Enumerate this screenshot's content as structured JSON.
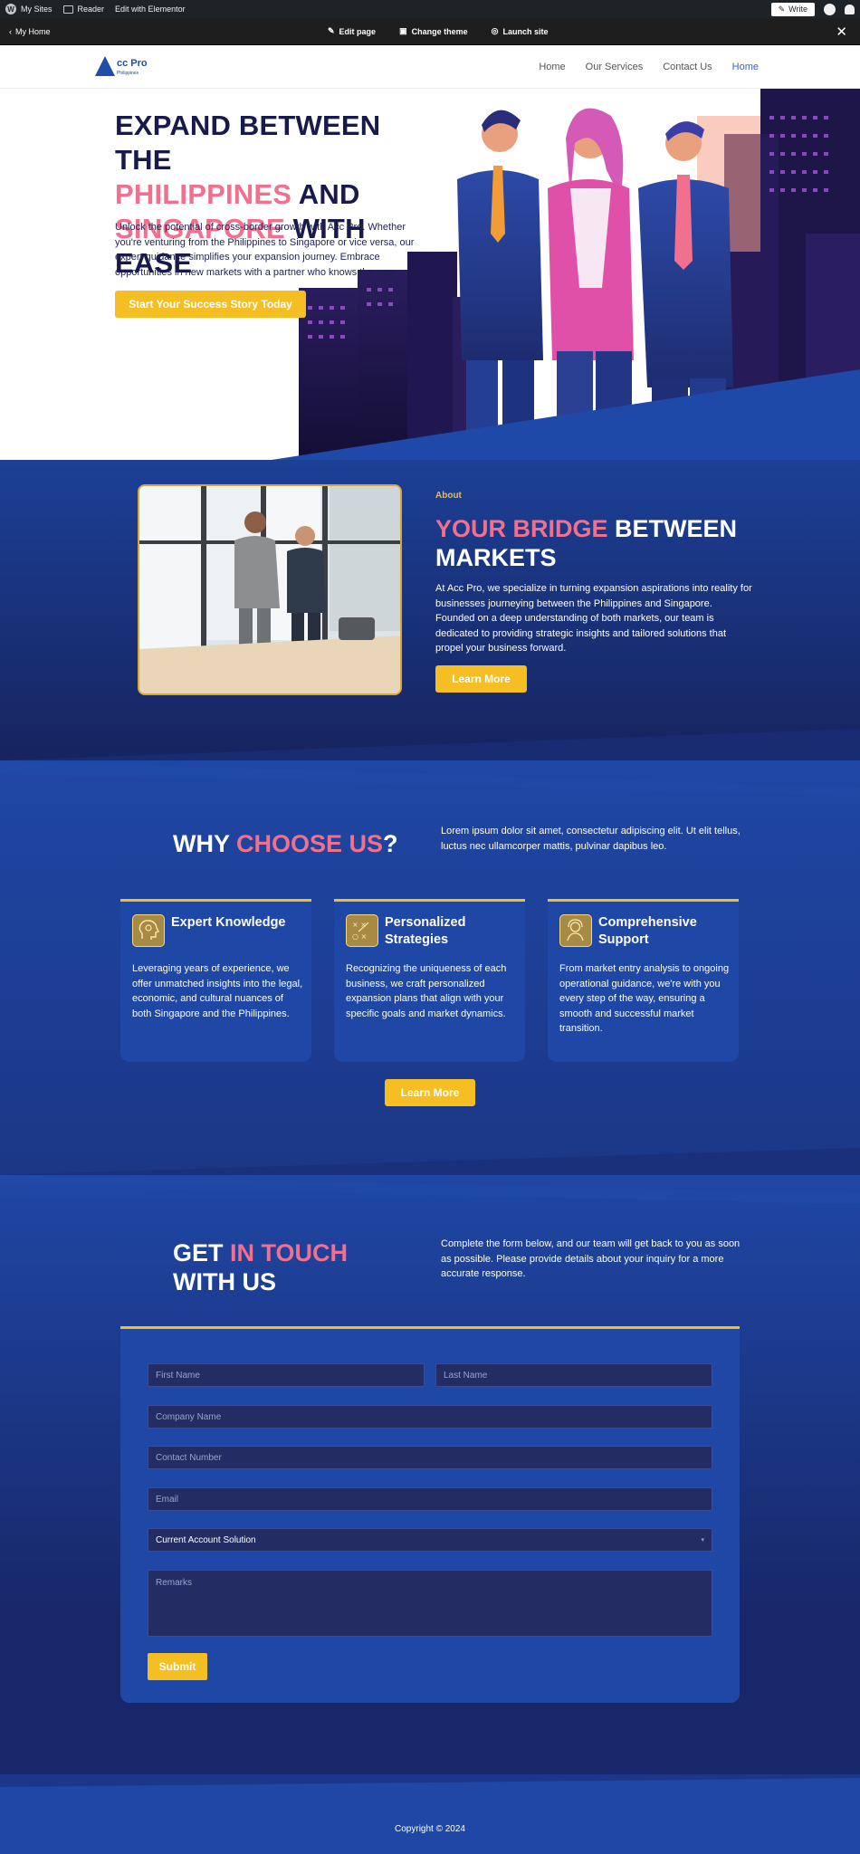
{
  "wpbar": {
    "my_sites": "My Sites",
    "reader": "Reader",
    "edit_elementor": "Edit with Elementor",
    "write": "Write"
  },
  "editor_bar": {
    "back": "My Home",
    "edit_page": "Edit page",
    "change_theme": "Change theme",
    "launch_site": "Launch site"
  },
  "header": {
    "logo_text": "cc Pro",
    "logo_sub": "Philippines",
    "nav": [
      "Home",
      "Our Services",
      "Contact Us",
      "Home"
    ]
  },
  "hero": {
    "title_line1": "EXPAND BETWEEN THE",
    "title_pink1": "PHILIPPINES",
    "title_and": " AND",
    "title_pink2": "SINGAPORE",
    "title_end": " WITH EASE",
    "description": "Unlock the potential of cross-border growth with Acc Pro. Whether you're venturing from the Philippines to Singapore or vice versa, our expert guidance simplifies your expansion journey. Embrace opportunities in new markets with a partner who knows the way.",
    "cta": "Start Your Success Story Today"
  },
  "about": {
    "label": "About",
    "title_pink": "YOUR BRIDGE",
    "title_rest": " BETWEEN MARKETS",
    "description": "At Acc Pro, we specialize in turning expansion aspirations into reality for businesses journeying between the Philippines and Singapore. Founded on a deep understanding of both markets, our team is dedicated to providing strategic insights and tailored solutions that propel your business forward.",
    "button": "Learn More"
  },
  "why": {
    "title_white": "WHY ",
    "title_pink": "CHOOSE US",
    "title_q": "?",
    "description": "Lorem ipsum dolor sit amet, consectetur adipiscing elit. Ut elit tellus, luctus nec ullamcorper mattis, pulvinar dapibus leo.",
    "cards": [
      {
        "title": "Expert Knowledge",
        "desc": "Leveraging years of experience, we offer unmatched insights into the legal, economic, and cultural nuances of both Singapore and the Philippines.",
        "icon": "head-idea-icon"
      },
      {
        "title": "Personalized Strategies",
        "desc": "Recognizing the uniqueness of each business, we craft personalized expansion plans that align with your specific goals and market dynamics.",
        "icon": "strategy-board-icon"
      },
      {
        "title": "Comprehensive Support",
        "desc": "From market entry analysis to ongoing operational guidance, we're with you every step of the way, ensuring a smooth and successful market transition.",
        "icon": "support-agent-icon"
      }
    ],
    "button": "Learn More"
  },
  "contact": {
    "title_white1": "GET ",
    "title_pink": "IN TOUCH",
    "title_white2": "WITH US",
    "description": "Complete the form below, and our team will get back to you as soon as possible. Please provide details about your inquiry for a more accurate response.",
    "form": {
      "first_name": "First Name",
      "last_name": "Last Name",
      "company": "Company Name",
      "contact_number": "Contact Number",
      "email": "Email",
      "select_value": "Current Account Solution",
      "remarks": "Remarks",
      "submit": "Submit"
    }
  },
  "footer": {
    "copyright": "Copyright © 2024"
  },
  "colors": {
    "navy": "#171a4a",
    "pink": "#f0708e",
    "yellow": "#f5bf23",
    "blue_bg": "#1c2a6b",
    "card_blue": "#1f47a5"
  }
}
